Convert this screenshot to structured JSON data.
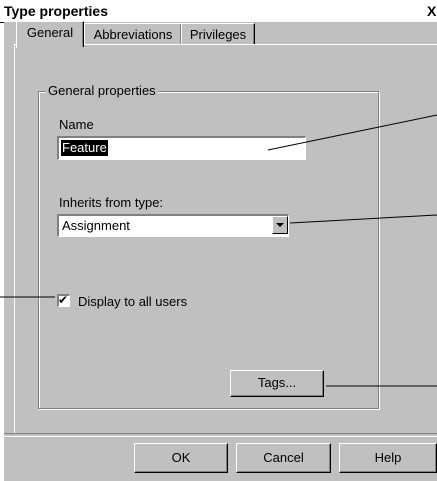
{
  "window": {
    "title": "Type properties",
    "close_glyph": "X"
  },
  "tabs": [
    {
      "label": "General",
      "active": true
    },
    {
      "label": "Abbreviations",
      "active": false
    },
    {
      "label": "Privileges",
      "active": false
    }
  ],
  "general": {
    "group_label": "General properties",
    "name_label": "Name",
    "name_value": "Feature",
    "inherits_label": "Inherits from type:",
    "inherits_value": "Assignment",
    "display_label": "Display to all users",
    "display_checked": true,
    "tags_button": "Tags..."
  },
  "footer": {
    "ok_label": "OK",
    "cancel_label": "Cancel",
    "help_label": "Help"
  },
  "icons": {
    "dropdown": "chevron-down-icon",
    "checkmark": "check-icon"
  }
}
